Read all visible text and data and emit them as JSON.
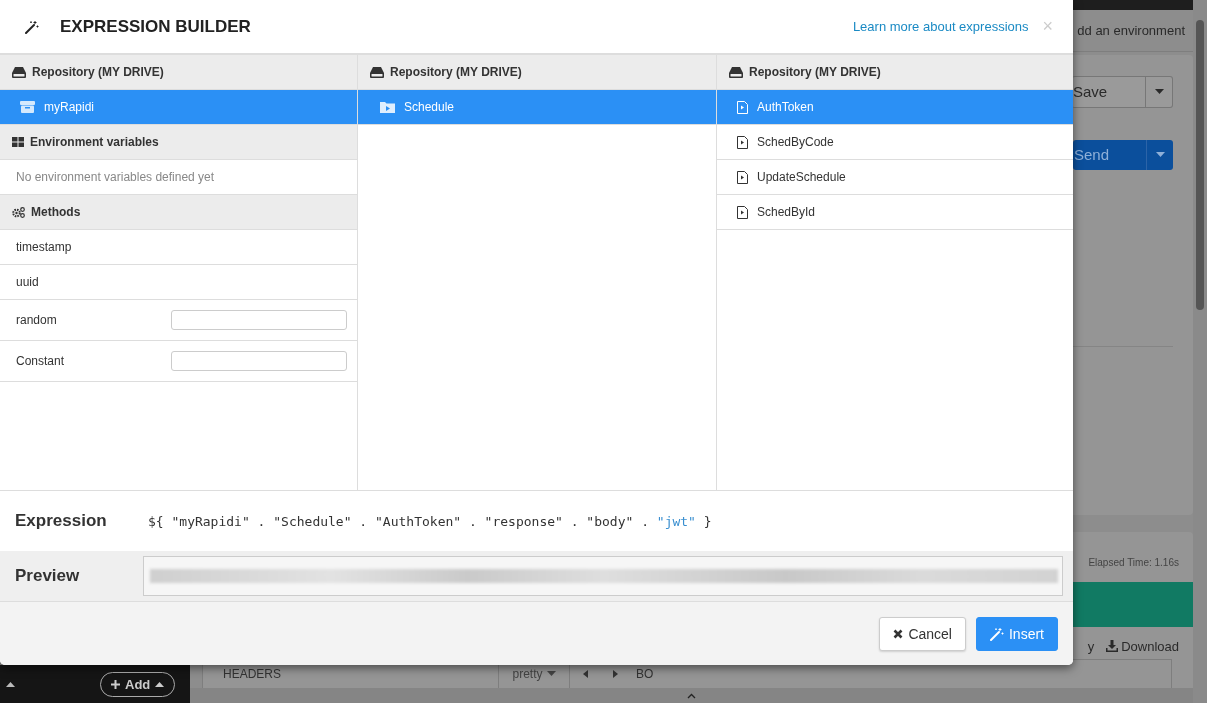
{
  "window": {
    "title": "EXPRESSION BUILDER",
    "help_link": "Learn more about expressions",
    "close": "×"
  },
  "columns": [
    {
      "header": "Repository (MY DRIVE)",
      "items": [
        {
          "label": "myRapidi",
          "kind": "repository",
          "selected": true
        }
      ],
      "sections": [
        {
          "kind": "environment",
          "title": "Environment variables",
          "empty_text": "No environment variables defined yet"
        },
        {
          "kind": "methods",
          "title": "Methods",
          "methods": [
            {
              "name": "timestamp",
              "kind": "plain"
            },
            {
              "name": "uuid",
              "kind": "plain"
            },
            {
              "name": "random",
              "kind": "input"
            },
            {
              "name": "Constant",
              "kind": "input"
            }
          ]
        }
      ]
    },
    {
      "header": "Repository (MY DRIVE)",
      "items": [
        {
          "label": "Schedule",
          "kind": "folder",
          "selected": true
        }
      ]
    },
    {
      "header": "Repository (MY DRIVE)",
      "items": [
        {
          "label": "AuthToken",
          "kind": "request",
          "selected": true
        },
        {
          "label": "SchedByCode",
          "kind": "request",
          "selected": false
        },
        {
          "label": "UpdateSchedule",
          "kind": "request",
          "selected": false
        },
        {
          "label": "SchedById",
          "kind": "request",
          "selected": false
        }
      ]
    }
  ],
  "expression": {
    "label": "Expression",
    "tokens": [
      {
        "text": "${",
        "selected": false
      },
      {
        "text": "\"myRapidi\"",
        "selected": false
      },
      {
        "text": ".",
        "selected": false
      },
      {
        "text": "\"Schedule\"",
        "selected": false
      },
      {
        "text": ".",
        "selected": false
      },
      {
        "text": "\"AuthToken\"",
        "selected": false
      },
      {
        "text": ".",
        "selected": false
      },
      {
        "text": "\"response\"",
        "selected": false
      },
      {
        "text": ".",
        "selected": false
      },
      {
        "text": "\"body\"",
        "selected": false
      },
      {
        "text": ".",
        "selected": false
      },
      {
        "text": "\"jwt\"",
        "selected": true
      },
      {
        "text": "}",
        "selected": false
      }
    ]
  },
  "preview": {
    "label": "Preview"
  },
  "buttons": [
    {
      "label": "Cancel",
      "kind": "cancel"
    },
    {
      "label": "Insert",
      "kind": "primary"
    }
  ],
  "background": {
    "environment_link": "dd an environment",
    "save_button": "Save",
    "send_button": "Send",
    "elapsed": "Elapsed Time: 1.16s",
    "response_tools": [
      "y",
      "Download"
    ],
    "headers_tab": "HEADERS",
    "format_select": "pretty",
    "body_tab": "BO",
    "add_button": "Add"
  }
}
